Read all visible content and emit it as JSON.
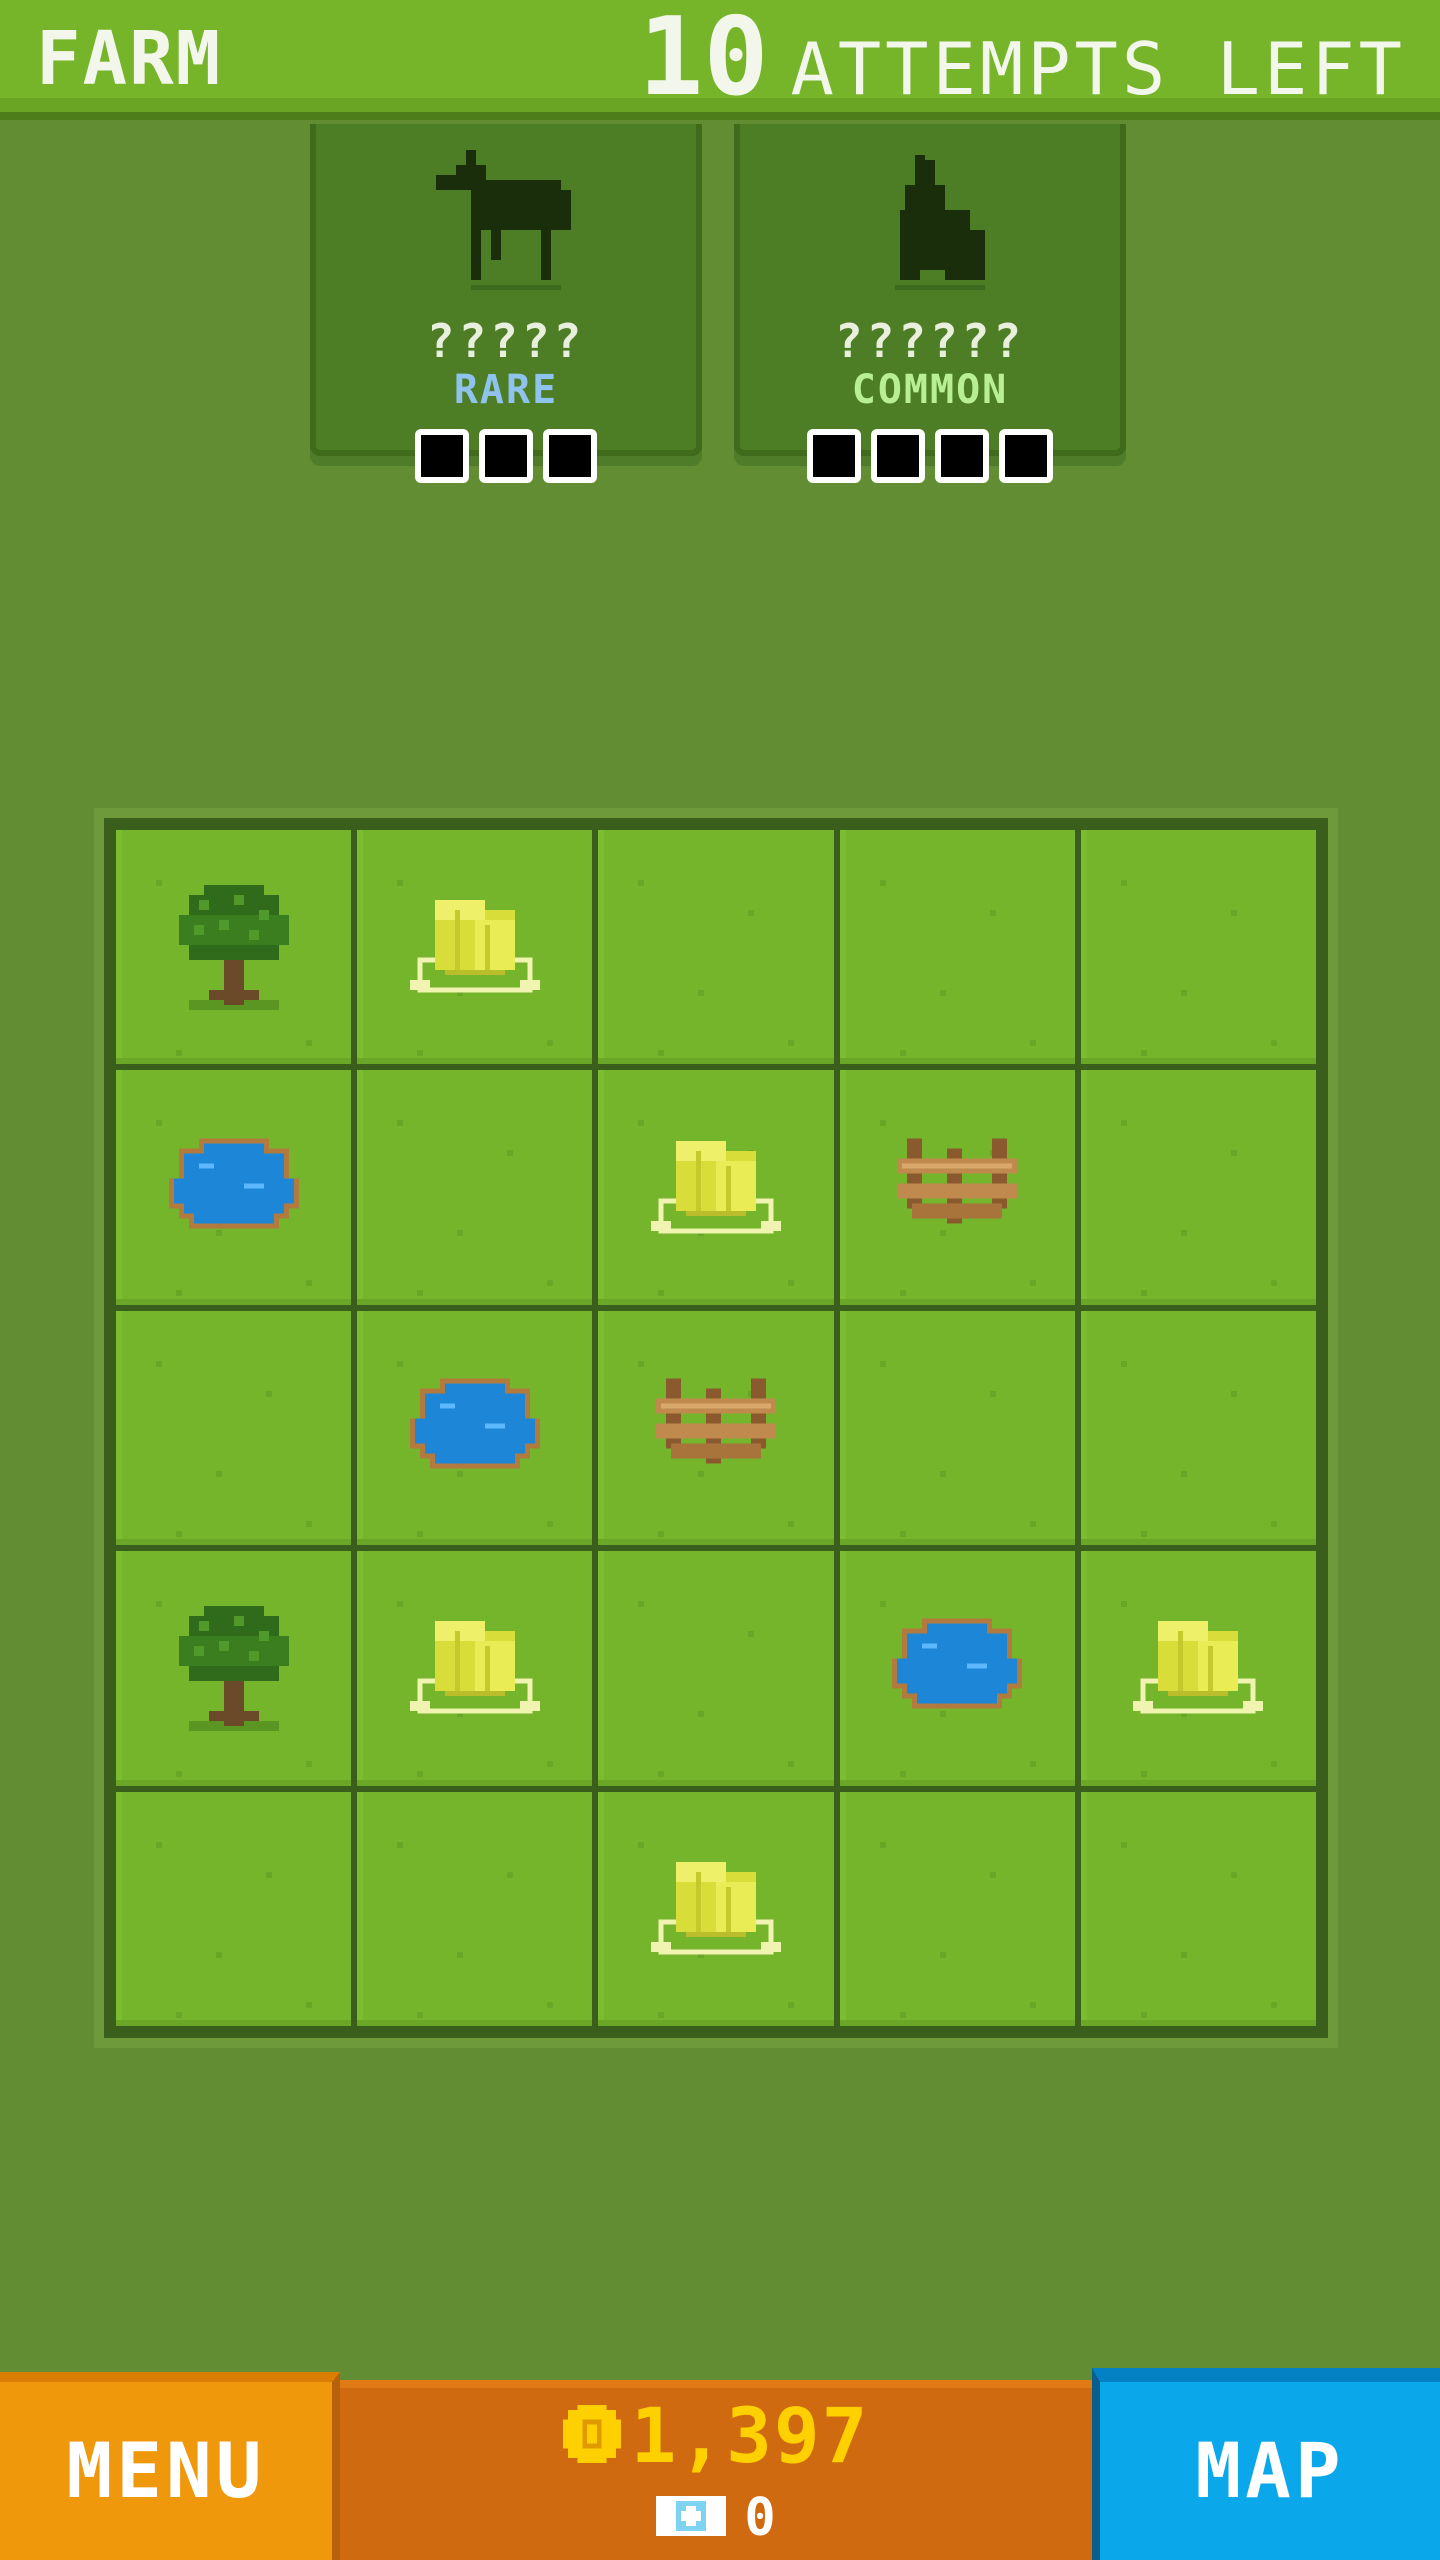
{
  "header": {
    "area_title": "FARM",
    "attempts_count": "10",
    "attempts_label": "ATTEMPTS LEFT"
  },
  "animal_cards": [
    {
      "silhouette_icon": "horse-silhouette-icon",
      "name": "?????",
      "rarity": "RARE",
      "rarity_color": "#8fc3ee",
      "pips_total": 3,
      "pips_found": 0
    },
    {
      "silhouette_icon": "rabbit-silhouette-icon",
      "name": "??????",
      "rarity": "COMMON",
      "rarity_color": "#b9ef94",
      "pips_total": 4,
      "pips_found": 0
    }
  ],
  "grid": {
    "rows": 5,
    "cols": 5,
    "cells": [
      [
        "tree",
        "hay",
        "",
        "",
        ""
      ],
      [
        "pond",
        "",
        "hay",
        "fence",
        ""
      ],
      [
        "",
        "pond",
        "fence",
        "",
        ""
      ],
      [
        "tree",
        "hay",
        "",
        "pond",
        "hay"
      ],
      [
        "",
        "",
        "hay",
        "",
        ""
      ]
    ]
  },
  "footer": {
    "menu_label": "MENU",
    "map_label": "MAP",
    "coins": "1,397",
    "gems": "0"
  },
  "colors": {
    "background": "#628d33",
    "topbar": "#76b52a",
    "tile": "#74b52c",
    "menu_button": "#f0980c",
    "wallet": "#cf6a10",
    "map_button": "#0aa7ea",
    "coin_text": "#ffd000"
  }
}
